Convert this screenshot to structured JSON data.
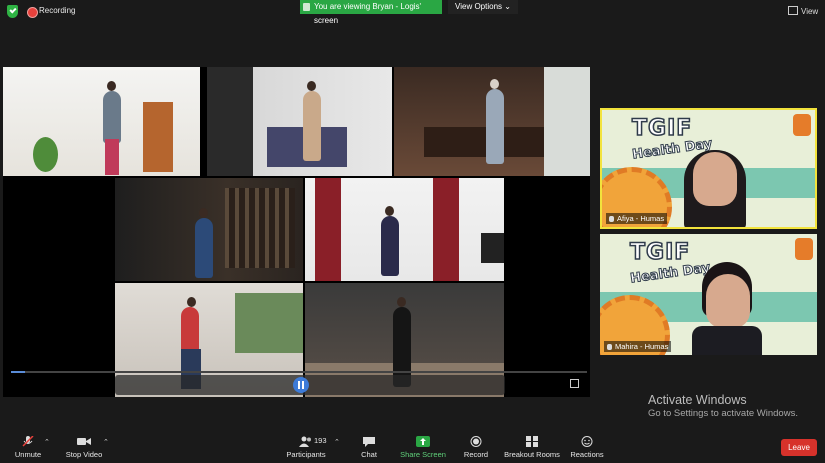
{
  "topbar": {
    "recording_label": "Recording",
    "viewing_banner": "You are viewing Bryan - Logis' screen",
    "view_options_label": "View Options",
    "view_button_label": "View"
  },
  "participants": [
    {
      "name": "Afiya - Humas",
      "active_speaker": true
    },
    {
      "name": "Mahira - Humas",
      "active_speaker": false
    }
  ],
  "background": {
    "title": "TGIF",
    "subtitle": "Health Day"
  },
  "watermark": {
    "line1": "Activate Windows",
    "line2": "Go to Settings to activate Windows."
  },
  "toolbar": {
    "unmute_label": "Unmute",
    "stop_video_label": "Stop Video",
    "participants_label": "Participants",
    "participants_count": "193",
    "chat_label": "Chat",
    "share_screen_label": "Share Screen",
    "record_label": "Record",
    "breakout_rooms_label": "Breakout Rooms",
    "reactions_label": "Reactions",
    "leave_label": "Leave"
  },
  "colors": {
    "accent_green": "#2aa744",
    "leave_red": "#d7322b",
    "active_border": "#f2e33c"
  }
}
